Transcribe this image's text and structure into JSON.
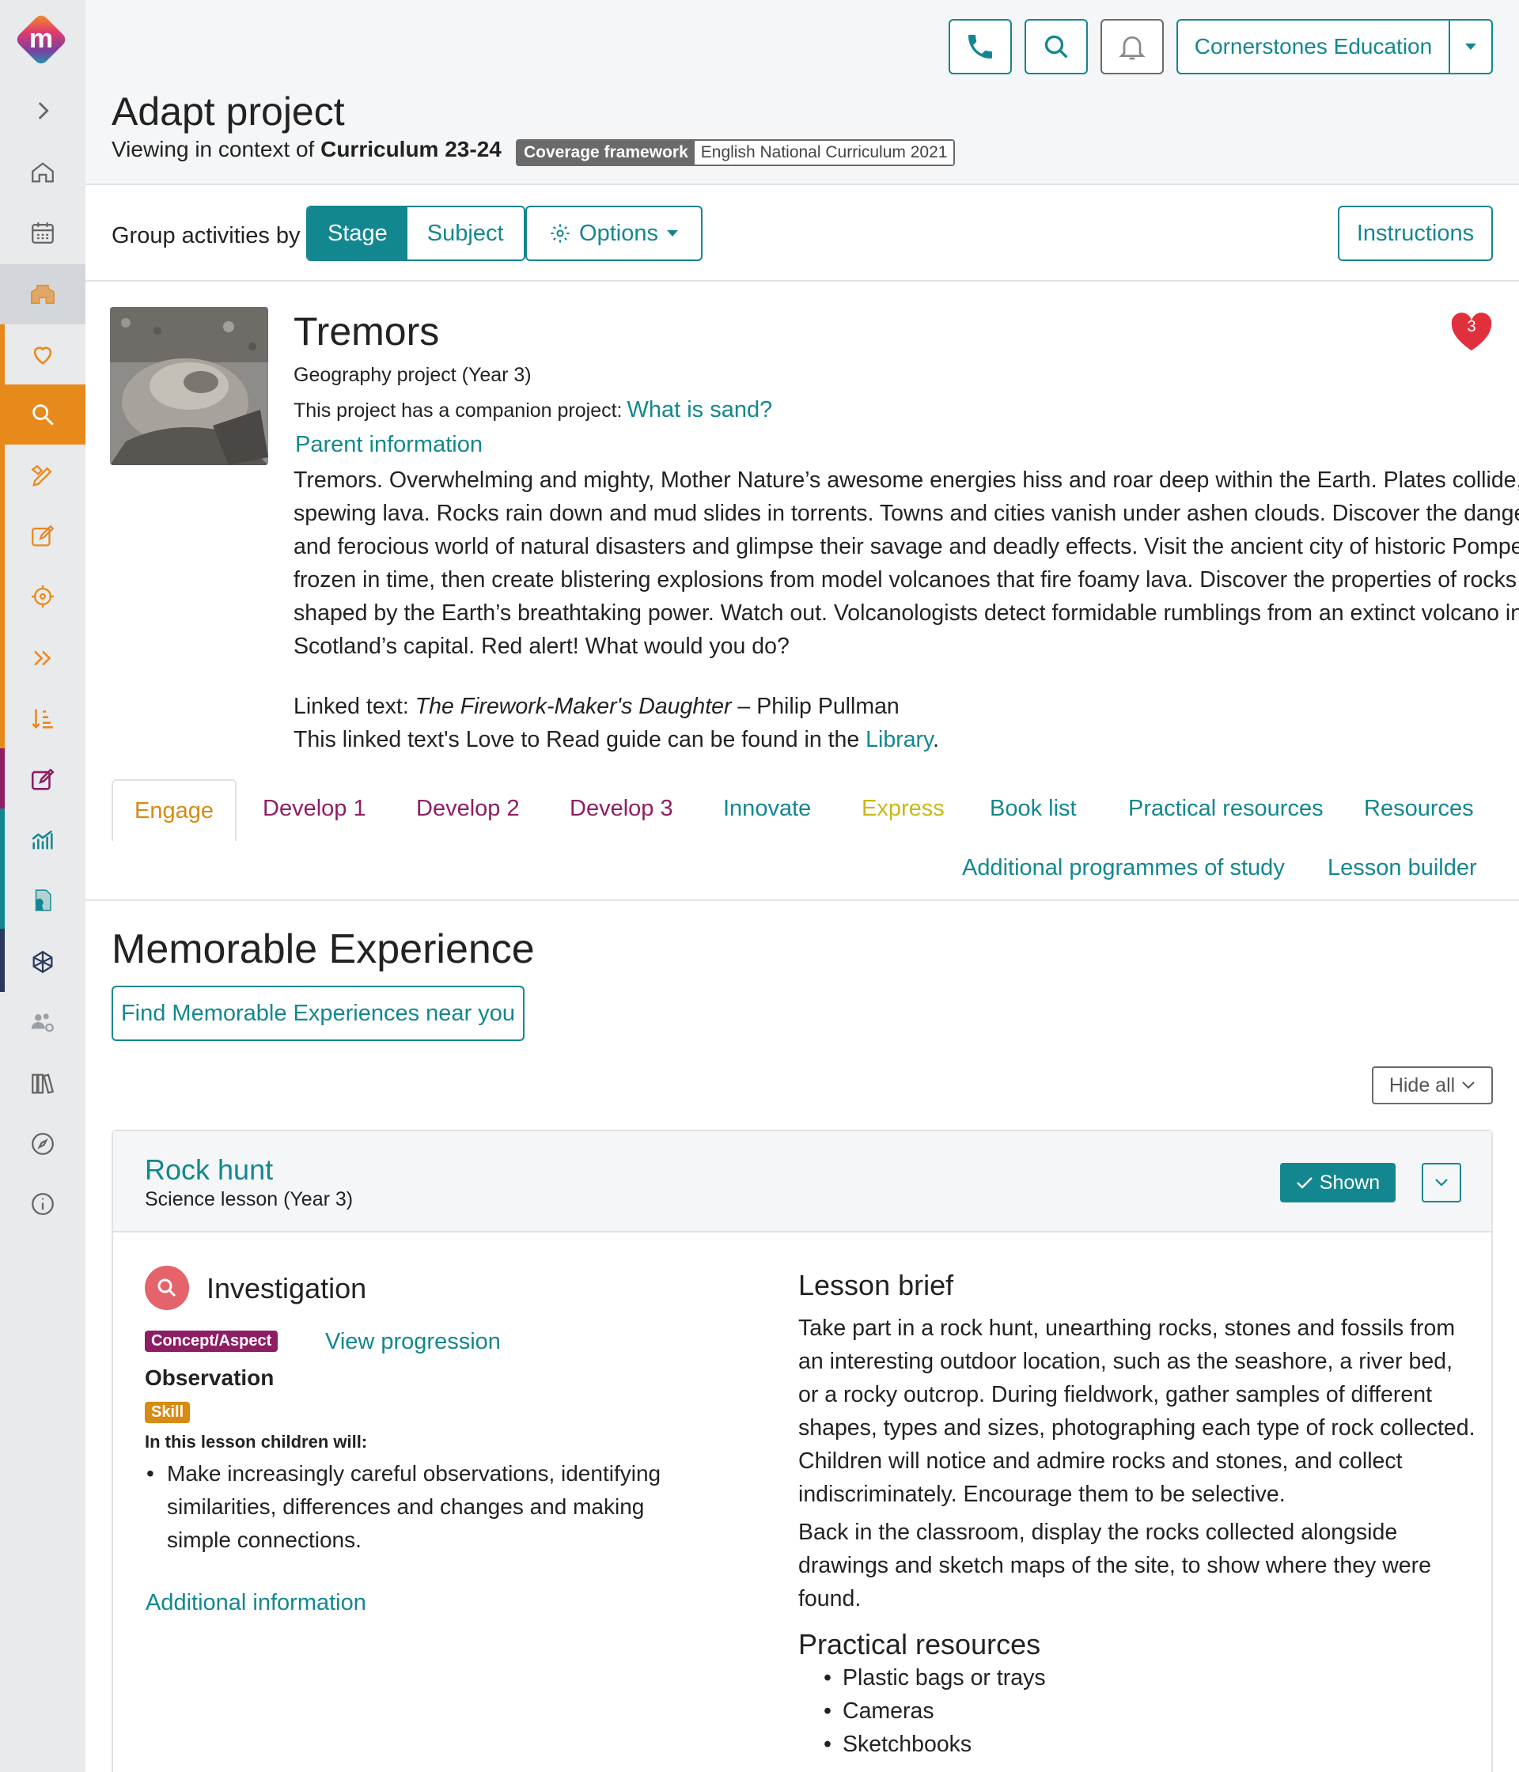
{
  "sidebar": {
    "logo_letter": "m",
    "items": [
      "expand-icon",
      "home-icon",
      "calendar-icon",
      "school-icon",
      "heart-icon",
      "search-icon",
      "pencil-ruler-icon",
      "edit-icon",
      "target-icon",
      "fast-forward-icon",
      "sort-icon",
      "edit-square-icon",
      "chart-icon",
      "certificate-icon",
      "network-icon",
      "users-settings-icon",
      "library-icon",
      "compass-icon",
      "info-icon"
    ]
  },
  "header": {
    "school_name": "Cornerstones Education",
    "title": "Adapt project",
    "context_prefix": "Viewing in context of",
    "context_value": "Curriculum 23-24",
    "coverage_key": "Coverage framework",
    "coverage_value": "English National Curriculum 2021"
  },
  "toolbar": {
    "group_label": "Group activities by",
    "stage": "Stage",
    "subject": "Subject",
    "options": "Options",
    "instructions": "Instructions"
  },
  "project": {
    "title": "Tremors",
    "favourites": "3",
    "subtitle": "Geography project (Year 3)",
    "companion_prefix": "This project has a companion project:",
    "companion_link": "What is sand?",
    "parent_info": "Parent information",
    "description": "Tremors. Overwhelming and mighty, Mother Nature’s awesome energies hiss and roar deep within the Earth. Plates collide, spewing lava. Rocks rain down and mud slides in torrents. Towns and cities vanish under ashen clouds. Discover the dangerous and ferocious world of natural disasters and glimpse their savage and deadly effects. Visit the ancient city of historic Pompeii, frozen in time, then create blistering explosions from model volcanoes that fire foamy lava. Discover the properties of rocks shaped by the Earth’s breathtaking power. Watch out. Volcanologists detect formidable rumblings from an extinct volcano in Scotland’s capital. Red alert! What would you do?",
    "linked_prefix": "Linked text:",
    "linked_title": "The Firework-Maker's Daughter",
    "linked_author": "– Philip Pullman",
    "guide_prefix": "This linked text's Love to Read guide can be found in the",
    "guide_link": "Library",
    "guide_suffix": "."
  },
  "tabs": {
    "engage": "Engage",
    "develop1": "Develop 1",
    "develop2": "Develop 2",
    "develop3": "Develop 3",
    "innovate": "Innovate",
    "express": "Express",
    "booklist": "Book list",
    "practical": "Practical resources",
    "resources": "Resources",
    "additional": "Additional programmes of study",
    "builder": "Lesson builder"
  },
  "section": {
    "title": "Memorable Experience",
    "find_button": "Find Memorable Experiences near you",
    "hide_all": "Hide all"
  },
  "lesson": {
    "title": "Rock hunt",
    "subtitle": "Science lesson (Year 3)",
    "shown": "Shown",
    "type_label": "Investigation",
    "concept_badge": "Concept/Aspect",
    "view_progression": "View progression",
    "observation": "Observation",
    "skill_badge": "Skill",
    "children_will": "In this lesson children will:",
    "objectives": [
      "Make increasingly careful observations, identifying similarities, differences and changes and making simple connections."
    ],
    "additional_info": "Additional information",
    "brief_heading": "Lesson brief",
    "brief_p1": "Take part in a rock hunt, unearthing rocks, stones and fossils from an interesting outdoor location, such as the seashore, a river bed, or a rocky outcrop. During fieldwork, gather samples of different shapes, types and sizes, photographing each type of rock collected. Children will notice and admire rocks and stones, and collect indiscriminately. Encourage them to be selective.",
    "brief_p2": "Back in the classroom, display the rocks collected alongside drawings and sketch maps of the site, to show where they were found.",
    "practical_heading": "Practical resources",
    "practical_items": [
      "Plastic bags or trays",
      "Cameras",
      "Sketchbooks"
    ]
  },
  "colors": {
    "accent": "#13878f",
    "engage": "#d88a12",
    "develop": "#8e1e64",
    "express": "#c9b91a",
    "heart": "#e1303c",
    "sidebar_orange": "#e8891c"
  }
}
